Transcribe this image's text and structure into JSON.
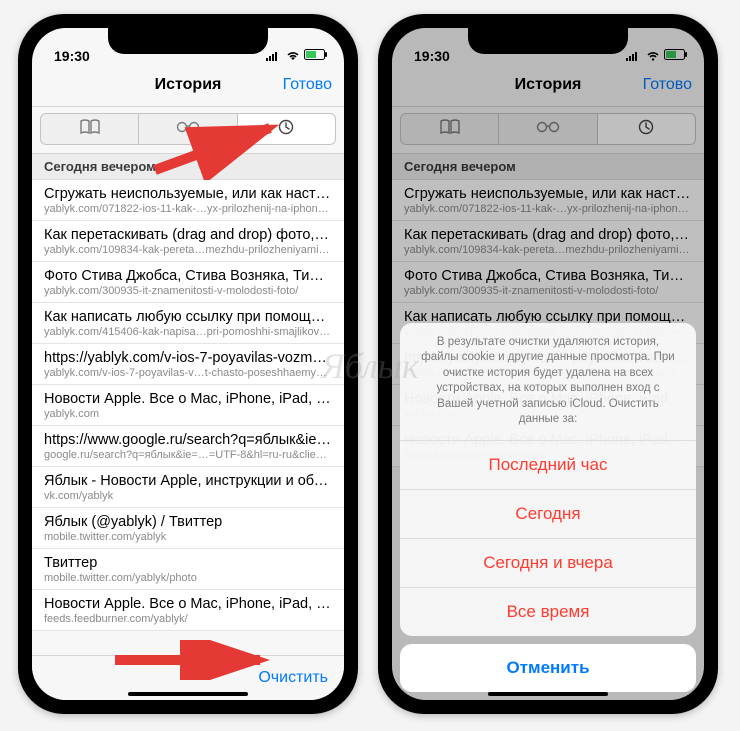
{
  "status": {
    "time": "19:30"
  },
  "header": {
    "title": "История",
    "done": "Готово"
  },
  "section_header": "Сегодня вечером",
  "rows": [
    {
      "title": "Сгружать неиспользуемые, или как настрои…",
      "url": "yablyk.com/071822-ios-11-kak-…yx-prilozhenij-na-iphone-i-ipad/"
    },
    {
      "title": "Как перетаскивать (drag and drop) фото, тек…",
      "url": "yablyk.com/109834-kak-pereta…mezhdu-prilozheniyami-na-ipad/"
    },
    {
      "title": "Фото Стива Джобса, Стива Возняка, Тима Ку…",
      "url": "yablyk.com/300935-it-znamenitosti-v-molodosti-foto/"
    },
    {
      "title": "Как написать любую ссылку при помощи см…",
      "url": "yablyk.com/415406-kak-napisa…pri-pomoshhi-smajlikov-emodzi/"
    },
    {
      "title": "https://yablyk.com/v-ios-7-poyavilas-vozmozh…",
      "url": "yablyk.com/v-ios-7-poyavilas-v…t-chasto-poseshhaemye-mesta/"
    },
    {
      "title": "Новости Apple. Все о Mac, iPhone, iPad, iOS,…",
      "url": "yablyk.com"
    },
    {
      "title": "https://www.google.ru/search?q=яблык&ie=U…",
      "url": "google.ru/search?q=яблык&ie=…=UTF-8&hl=ru-ru&client=safari"
    },
    {
      "title": "Яблык - Новости Apple, инструкции и обзор…",
      "url": "vk.com/yablyk"
    },
    {
      "title": "Яблык (@yablyk) / Твиттер",
      "url": "mobile.twitter.com/yablyk"
    },
    {
      "title": "Твиттер",
      "url": "mobile.twitter.com/yablyk/photo"
    },
    {
      "title": "Новости Apple. Все о Mac, iPhone, iPad, iOS,…",
      "url": "feeds.feedburner.com/yablyk/"
    }
  ],
  "footer": {
    "clear": "Очистить"
  },
  "sheet": {
    "message": "В результате очистки удаляются история, файлы cookie и другие данные просмотра. При очистке история будет удалена на всех устройствах, на которых выполнен вход с Вашей учетной записью iCloud. Очистить данные за:",
    "options": [
      "Последний час",
      "Сегодня",
      "Сегодня и вчера",
      "Все время"
    ],
    "cancel": "Отменить"
  },
  "watermark": "Яблык"
}
